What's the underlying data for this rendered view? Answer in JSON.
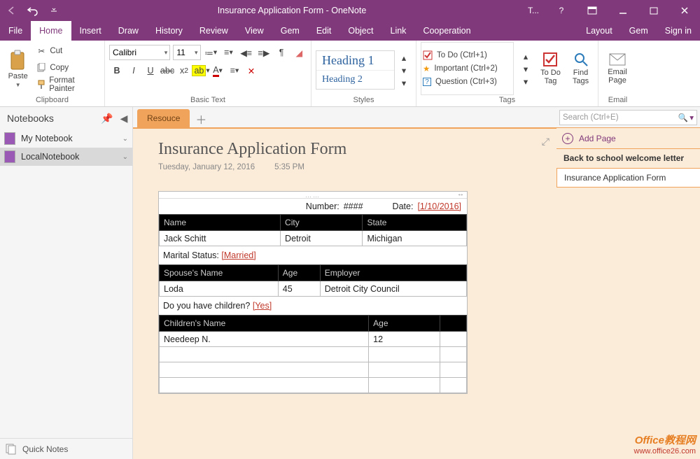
{
  "window": {
    "title": "Insurance Application Form - OneNote",
    "tell_me": "T...",
    "signin": "Sign in"
  },
  "menu": {
    "file": "File",
    "home": "Home",
    "insert": "Insert",
    "draw": "Draw",
    "history": "History",
    "review": "Review",
    "view": "View",
    "gem": "Gem",
    "edit": "Edit",
    "object": "Object",
    "link": "Link",
    "cooperation": "Cooperation",
    "layout": "Layout",
    "gem2": "Gem"
  },
  "ribbon": {
    "clipboard": {
      "paste": "Paste",
      "cut": "Cut",
      "copy": "Copy",
      "painter": "Format Painter",
      "label": "Clipboard"
    },
    "font": {
      "name": "Calibri",
      "size": "11",
      "label": "Basic Text"
    },
    "styles": {
      "h1": "Heading 1",
      "h2": "Heading 2",
      "label": "Styles"
    },
    "tags": {
      "todo": "To Do (Ctrl+1)",
      "important": "Important (Ctrl+2)",
      "question": "Question (Ctrl+3)",
      "todo_btn": "To Do Tag",
      "find": "Find Tags",
      "label": "Tags"
    },
    "email": {
      "btn": "Email Page",
      "label": "Email"
    }
  },
  "sidebar": {
    "title": "Notebooks",
    "notebooks": [
      {
        "name": "My Notebook",
        "color": "#9b59b6"
      },
      {
        "name": "LocalNotebook",
        "color": "#9b59b6"
      }
    ],
    "quicknotes": "Quick Notes"
  },
  "section": {
    "tab": "Resouce"
  },
  "page": {
    "title": "Insurance Application Form",
    "date": "Tuesday, January 12, 2016",
    "time": "5:35 PM"
  },
  "form": {
    "number_label": "Number:",
    "number_val": "####",
    "date_label": "Date:",
    "date_val": "[1/10/2016]",
    "t1_headers": [
      "Name",
      "City",
      "State"
    ],
    "t1_row": [
      "Jack Schitt",
      "Detroit",
      "Michigan"
    ],
    "marital_label": "Marital Status:",
    "marital_val": "[Married]",
    "t2_headers": [
      "Spouse's Name",
      "Age",
      "Employer"
    ],
    "t2_row": [
      "Loda",
      "45",
      "Detroit City Council"
    ],
    "children_q": "Do you have children?",
    "children_a": "[Yes]",
    "t3_headers": [
      "Children's Name",
      "Age",
      ""
    ],
    "t3_rows": [
      [
        "Needeep N.",
        "12",
        ""
      ],
      [
        "",
        "",
        ""
      ],
      [
        "",
        "",
        ""
      ],
      [
        "",
        "",
        ""
      ]
    ]
  },
  "rightpane": {
    "search_placeholder": "Search (Ctrl+E)",
    "addpage": "Add Page",
    "pages": [
      {
        "title": "Back to school welcome letter",
        "sel": false,
        "bold": true
      },
      {
        "title": "Insurance Application Form",
        "sel": true,
        "bold": false
      }
    ]
  },
  "watermark": {
    "t1": "Office教程网",
    "t2": "www.office26.com"
  }
}
